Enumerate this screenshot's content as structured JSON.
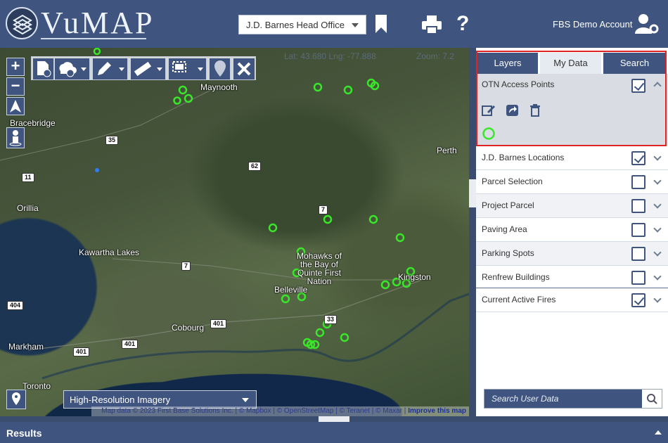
{
  "header": {
    "logo_text": "VuMAP",
    "office_selected": "J.D. Barnes Head Office",
    "account_label": "FBS Demo Account",
    "help_symbol": "?"
  },
  "map": {
    "coords": "Lat: 43.680  Lng: -77.888",
    "zoom": "Zoom: 7.2",
    "imagery": "High-Resolution Imagery",
    "attribution_prefix": "Map data © 2023 First Base Solutions Inc. | © Mapbox | © OpenStreetMap | © Teranet | © Maxar |",
    "attribution_link": "Improve this map",
    "places": [
      {
        "id": "bracebridge",
        "label": "Bracebridge"
      },
      {
        "id": "maynooth",
        "label": "Maynooth"
      },
      {
        "id": "perth",
        "label": "Perth"
      },
      {
        "id": "orillia",
        "label": "Orillia"
      },
      {
        "id": "kawartha",
        "label": "Kawartha Lakes"
      },
      {
        "id": "mohawks",
        "label": "Mohawks of the Bay of Quinte First Nation"
      },
      {
        "id": "kingston",
        "label": "Kingston"
      },
      {
        "id": "belleville",
        "label": "Belleville"
      },
      {
        "id": "cobourg",
        "label": "Cobourg"
      },
      {
        "id": "markham",
        "label": "Markham"
      },
      {
        "id": "toronto",
        "label": "Toronto"
      }
    ],
    "shields": [
      "35",
      "11",
      "62",
      "7",
      "7",
      "404",
      "401",
      "401",
      "401",
      "33"
    ]
  },
  "panel": {
    "tabs": [
      "Layers",
      "My Data",
      "Search"
    ],
    "active_tab": "My Data",
    "open_layer": {
      "name": "OTN Access Points",
      "checked": true
    },
    "layers": [
      {
        "name": "J.D. Barnes Locations",
        "checked": true
      },
      {
        "name": "Parcel Selection",
        "checked": false
      },
      {
        "name": "Project Parcel",
        "checked": false
      },
      {
        "name": "Paving Area",
        "checked": false
      },
      {
        "name": "Parking Spots",
        "checked": false
      },
      {
        "name": "Renfrew Buildings",
        "checked": false
      },
      {
        "name": "Current Active Fires",
        "checked": true
      }
    ],
    "search_placeholder": "Search User Data"
  },
  "results": {
    "label": "Results"
  },
  "colors": {
    "accent": "#3f5580",
    "point": "#39e62a",
    "highlight": "#e02424"
  }
}
